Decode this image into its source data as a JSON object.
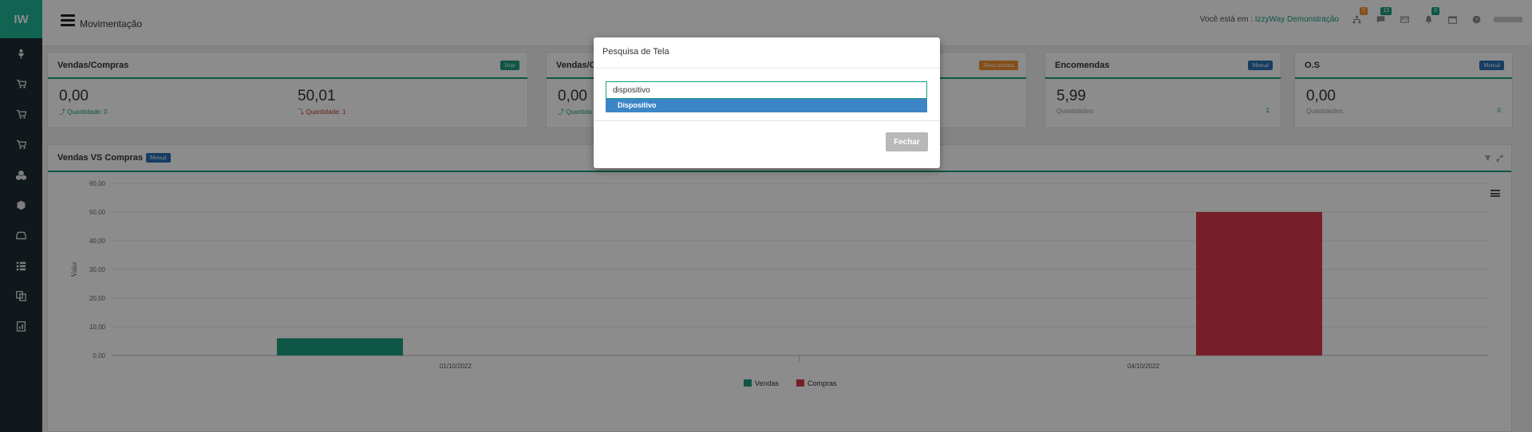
{
  "sidebar": {
    "logo": "IW",
    "items": [
      {
        "icon": "user-icon"
      },
      {
        "icon": "cart-icon"
      },
      {
        "icon": "cart-icon"
      },
      {
        "icon": "cart-icon"
      },
      {
        "icon": "cubes-icon"
      },
      {
        "icon": "cube-icon"
      },
      {
        "icon": "inbox-icon"
      },
      {
        "icon": "list-icon"
      },
      {
        "icon": "copy-icon"
      },
      {
        "icon": "file-chart-icon"
      }
    ]
  },
  "topbar": {
    "title": "Movimentação",
    "you_are_in": "Você está em :",
    "company": "IzzyWay Demonstração",
    "badges": {
      "tasks": "0",
      "messages": "13",
      "notifications": "0"
    },
    "badge_colors": {
      "orange": "#f0902f",
      "teal": "#1a9d80"
    }
  },
  "cards": [
    {
      "title": "Vendas/Compras",
      "tag": "Hoje",
      "tag_color": "green",
      "value_left": "0,00",
      "sub_left": "Quantidade: 0",
      "value_right": "50,01",
      "sub_right": "Quantidade: 1"
    },
    {
      "title": "Vendas/C",
      "tag": "Nesta semana",
      "tag_color": "orange",
      "value_left": "0,00",
      "sub_left": "Quantida"
    },
    {
      "title": "Encomendas",
      "tag": "Mensal",
      "tag_color": "blue",
      "value": "5,99",
      "sub": "Quantidades:",
      "count": "1"
    },
    {
      "title": "O.S",
      "tag": "Mensal",
      "tag_color": "blue",
      "value": "0,00",
      "sub": "Quantidades:",
      "count": "0"
    }
  ],
  "chart_panel": {
    "title": "Vendas VS Compras",
    "tag": "Mensal"
  },
  "chart_data": {
    "type": "bar",
    "categories": [
      "01/10/2022",
      "04/10/2022"
    ],
    "series": [
      {
        "name": "Vendas",
        "color": "#1a9d80",
        "values": [
          5.99,
          0
        ]
      },
      {
        "name": "Compras",
        "color": "#d9394a",
        "values": [
          0,
          50.01
        ]
      }
    ],
    "ylabel": "Valor",
    "ylim": [
      0,
      60
    ],
    "yticks": [
      "0,00",
      "10,00",
      "20,00",
      "30,00",
      "40,00",
      "50,00",
      "60,00"
    ],
    "grid": true,
    "legend": "bottom-center"
  },
  "modal": {
    "title": "Pesquisa de Tela",
    "input_value": "dispositivo",
    "suggestion": "Dispositivo",
    "close_label": "Fechar"
  }
}
